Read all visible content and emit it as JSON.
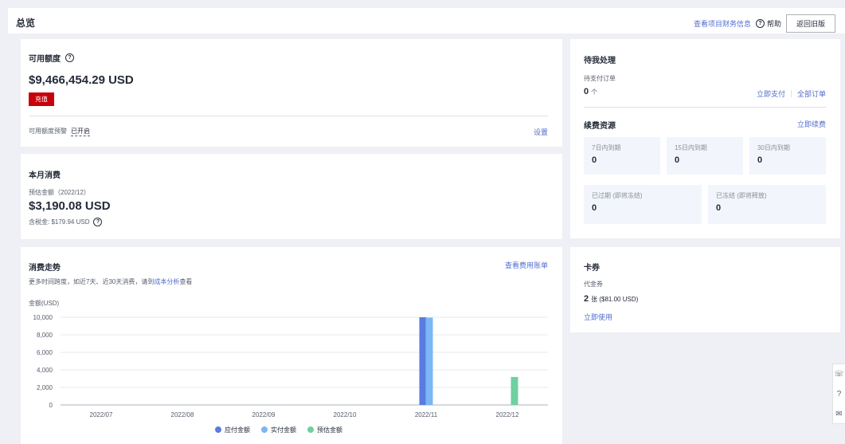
{
  "header": {
    "title": "总览",
    "finance_link": "查看项目财务信息",
    "help_label": "帮助",
    "back_button": "返回旧版"
  },
  "credit": {
    "title": "可用额度",
    "amount": "$9,466,454.29 USD",
    "recharge_button": "充值",
    "alert_label": "可用额度预警",
    "alert_status": "已开启",
    "settings_link": "设置"
  },
  "monthly": {
    "title": "本月消费",
    "estimate_label": "预估金额（2022/12）",
    "amount": "$3,190.08 USD",
    "tax_label": "含税金: $179.94 USD"
  },
  "trend": {
    "title": "消费走势",
    "bill_link": "查看费用账单",
    "desc_prefix": "更多时间跨度，如近7天、近30天消费，请到",
    "desc_link": "成本分析",
    "desc_suffix": "查看"
  },
  "pending": {
    "title": "待我处理",
    "orders_label": "待支付订单",
    "orders_count": "0",
    "orders_unit": "个",
    "pay_now": "立即支付",
    "all_orders": "全部订单"
  },
  "renewal": {
    "title": "续费资源",
    "renew_now": "立即续费",
    "boxes": [
      {
        "label": "7日内到期",
        "value": "0"
      },
      {
        "label": "15日内到期",
        "value": "0"
      },
      {
        "label": "30日内到期",
        "value": "0"
      },
      {
        "label": "已过期 (即将冻结)",
        "value": "0"
      },
      {
        "label": "已冻结 (即将释放)",
        "value": "0"
      }
    ]
  },
  "coupons": {
    "title": "卡券",
    "voucher_label": "代金券",
    "voucher_count": "2",
    "voucher_detail": "张 ($81.00 USD)",
    "use_now": "立即使用"
  },
  "floating": {
    "icons": [
      "phone-icon",
      "question-icon",
      "mail-icon"
    ]
  },
  "chart_data": {
    "type": "bar",
    "title": "",
    "ylabel": "金额(USD)",
    "xlabel": "",
    "categories": [
      "2022/07",
      "2022/08",
      "2022/09",
      "2022/10",
      "2022/11",
      "2022/12"
    ],
    "series": [
      {
        "name": "应付金额",
        "color": "#5b7be0",
        "values": [
          0,
          0,
          0,
          0,
          10000,
          0
        ]
      },
      {
        "name": "实付金额",
        "color": "#7bb6f5",
        "values": [
          0,
          0,
          0,
          0,
          9950,
          0
        ]
      },
      {
        "name": "预估金额",
        "color": "#6fd0a0",
        "values": [
          0,
          0,
          0,
          0,
          0,
          3190
        ]
      }
    ],
    "yticks": [
      "10,000",
      "8,000",
      "6,000",
      "4,000",
      "2,000",
      "0"
    ],
    "ylim": [
      0,
      10000
    ],
    "grid": true,
    "legend": "bottom"
  }
}
